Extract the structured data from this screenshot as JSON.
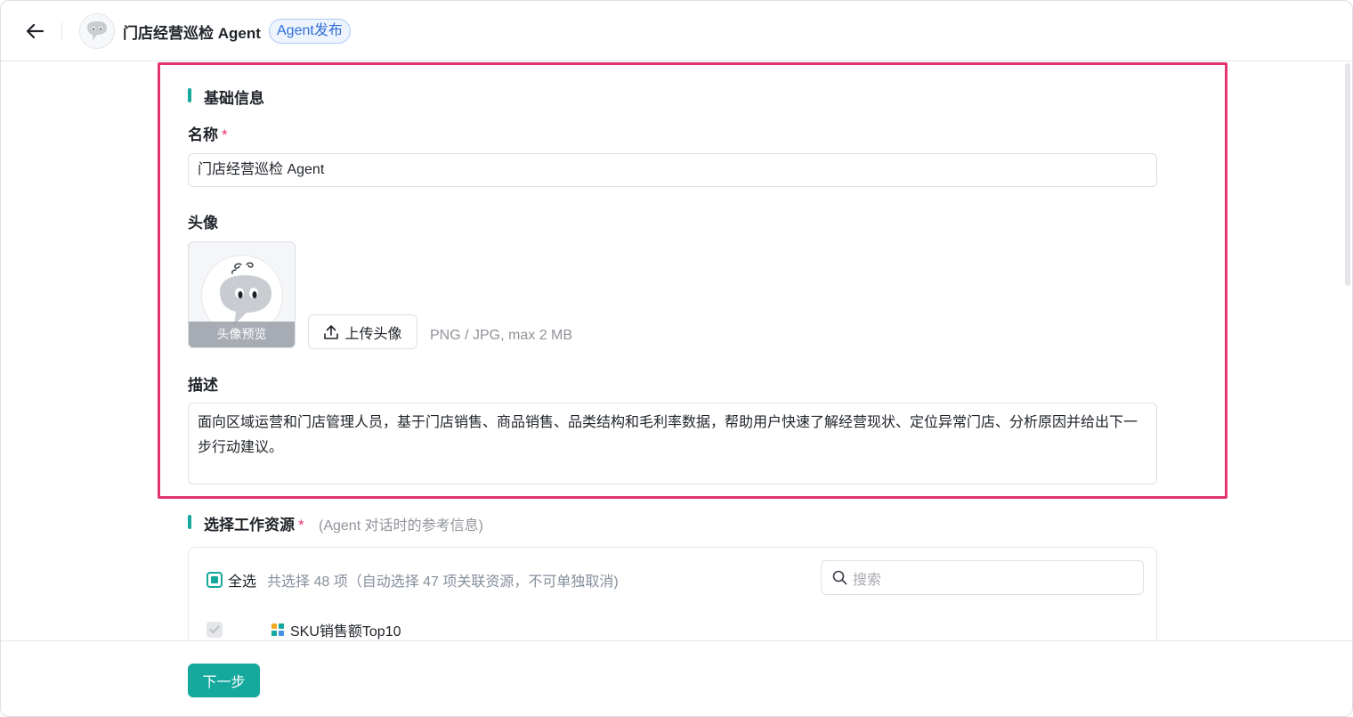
{
  "header": {
    "agent_name": "门店经营巡检 Agent",
    "publish_tag": "Agent发布"
  },
  "basic_info": {
    "section_title": "基础信息",
    "name_label": "名称",
    "name_required": "*",
    "name_value": "门店经营巡检 Agent",
    "avatar_label": "头像",
    "avatar_caption": "头像预览",
    "upload_button": "上传头像",
    "upload_hint": "PNG / JPG, max 2 MB",
    "description_label": "描述",
    "description_value": "面向区域运营和门店管理人员，基于门店销售、商品销售、品类结构和毛利率数据，帮助用户快速了解经营现状、定位异常门店、分析原因并给出下一步行动建议。"
  },
  "resources": {
    "section_title": "选择工作资源",
    "required": "*",
    "hint": "(Agent 对话时的参考信息)",
    "select_all_label": "全选",
    "selection_summary": "共选择 48 项（自动选择 47 项关联资源，不可单独取消)",
    "search_placeholder": "搜索",
    "rows": [
      {
        "name": "SKU销售额Top10"
      }
    ]
  },
  "footer": {
    "next_button": "下一步"
  },
  "colors": {
    "accent": "#15a89c",
    "highlight_border": "#e5336b",
    "tag_blue": "#2f6fd6"
  }
}
